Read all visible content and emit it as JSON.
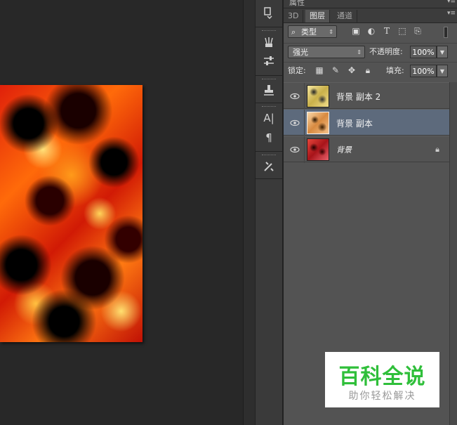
{
  "properties_panel": {
    "title": "属性",
    "menu_icon": "panel-menu-icon"
  },
  "layers_panel": {
    "tabs": [
      {
        "label": "3D",
        "active": false
      },
      {
        "label": "图层",
        "active": true
      },
      {
        "label": "通道",
        "active": false
      }
    ],
    "filter": {
      "selected": "类型",
      "icon": "search-icon"
    },
    "filter_icons": [
      "image-filter-icon",
      "adjustment-filter-icon",
      "type-filter-icon",
      "shape-filter-icon",
      "smart-object-filter-icon"
    ],
    "blend_mode": "强光",
    "opacity_label": "不透明度:",
    "opacity_value": "100%",
    "lock_label": "锁定:",
    "lock_icons": [
      "lock-transparent-icon",
      "lock-paint-icon",
      "lock-move-icon",
      "lock-all-icon"
    ],
    "fill_label": "填充:",
    "fill_value": "100%",
    "layers": [
      {
        "name": "背景 副本 2",
        "visible": true,
        "selected": false,
        "locked": false
      },
      {
        "name": "背景 副本",
        "visible": true,
        "selected": true,
        "locked": false
      },
      {
        "name": "背景",
        "visible": true,
        "selected": false,
        "locked": true
      }
    ]
  },
  "tool_strip": [
    "history-icon",
    "brush-preset-icon",
    "adjustments-icon",
    "clone-source-icon",
    "character-icon",
    "paragraph-icon",
    "tool-presets-icon"
  ],
  "watermark": {
    "title": "百科全说",
    "subtitle": "助你轻松解决"
  },
  "colors": {
    "panel_bg": "#535353",
    "selected_layer": "#5d6a7c",
    "watermark_green": "#2fbf3a"
  }
}
